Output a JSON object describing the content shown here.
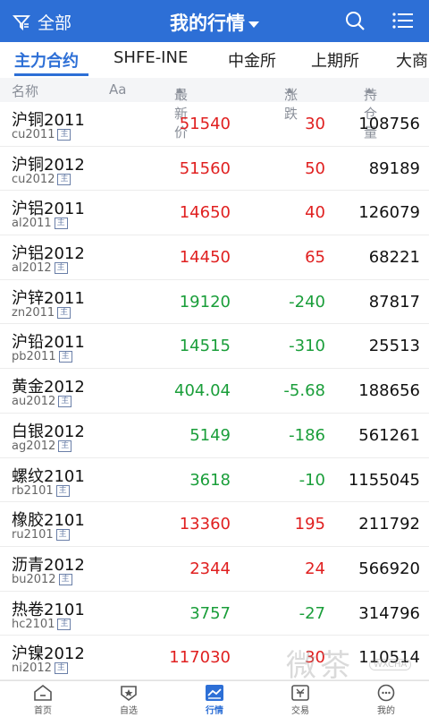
{
  "topbar": {
    "filter_label": "全部",
    "title": "我的行情"
  },
  "tabs": [
    "主力合约",
    "SHFE-INE",
    "中金所",
    "上期所",
    "大商"
  ],
  "columns": {
    "name": "名称",
    "aa": "Aa",
    "price": "最新价",
    "change": "涨跌",
    "oi": "持仓量"
  },
  "main_badge": "主",
  "rows": [
    {
      "name": "沪铜2011",
      "code": "cu2011",
      "price": "51540",
      "change": "30",
      "oi": "108756",
      "dir": "up"
    },
    {
      "name": "沪铜2012",
      "code": "cu2012",
      "price": "51560",
      "change": "50",
      "oi": "89189",
      "dir": "up"
    },
    {
      "name": "沪铝2011",
      "code": "al2011",
      "price": "14650",
      "change": "40",
      "oi": "126079",
      "dir": "up"
    },
    {
      "name": "沪铝2012",
      "code": "al2012",
      "price": "14450",
      "change": "65",
      "oi": "68221",
      "dir": "up"
    },
    {
      "name": "沪锌2011",
      "code": "zn2011",
      "price": "19120",
      "change": "-240",
      "oi": "87817",
      "dir": "down"
    },
    {
      "name": "沪铅2011",
      "code": "pb2011",
      "price": "14515",
      "change": "-310",
      "oi": "25513",
      "dir": "down"
    },
    {
      "name": "黄金2012",
      "code": "au2012",
      "price": "404.04",
      "change": "-5.68",
      "oi": "188656",
      "dir": "down"
    },
    {
      "name": "白银2012",
      "code": "ag2012",
      "price": "5149",
      "change": "-186",
      "oi": "561261",
      "dir": "down"
    },
    {
      "name": "螺纹2101",
      "code": "rb2101",
      "price": "3618",
      "change": "-10",
      "oi": "1155045",
      "dir": "down"
    },
    {
      "name": "橡胶2101",
      "code": "ru2101",
      "price": "13360",
      "change": "195",
      "oi": "211792",
      "dir": "up"
    },
    {
      "name": "沥青2012",
      "code": "bu2012",
      "price": "2344",
      "change": "24",
      "oi": "566920",
      "dir": "up"
    },
    {
      "name": "热卷2101",
      "code": "hc2101",
      "price": "3757",
      "change": "-27",
      "oi": "314796",
      "dir": "down"
    },
    {
      "name": "沪镍2012",
      "code": "ni2012",
      "price": "117030",
      "change": "30",
      "oi": "110514",
      "dir": "up"
    }
  ],
  "nav": [
    "首页",
    "自选",
    "行情",
    "交易",
    "我的"
  ],
  "watermark": {
    "text": "微茶",
    "badge": "WXCHA"
  },
  "colors": {
    "brand": "#2d6fd6",
    "up": "#e02020",
    "down": "#1a9e3a"
  }
}
